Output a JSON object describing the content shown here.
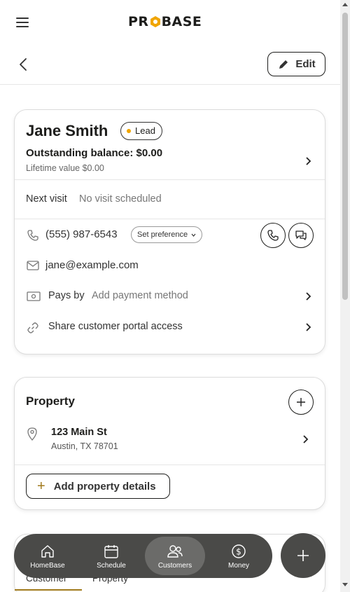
{
  "header": {
    "logo_left": "PR",
    "logo_right": "BASE",
    "edit_label": "Edit"
  },
  "customer": {
    "name": "Jane Smith",
    "status_badge": "Lead",
    "outstanding_balance": "Outstanding balance: $0.00",
    "lifetime_value": "Lifetime value $0.00",
    "next_visit_label": "Next visit",
    "next_visit_value": "No visit scheduled",
    "phone": "(555) 987-6543",
    "set_preference_label": "Set preference",
    "email": "jane@example.com",
    "pays_by_label": "Pays by",
    "pays_by_value": "Add payment method",
    "portal_label": "Share customer portal access"
  },
  "property": {
    "title": "Property",
    "address_line1": "123 Main St",
    "address_line2": "Austin, TX 78701",
    "add_details_label": "Add property details"
  },
  "tabs": [
    {
      "label": "Customer",
      "active": true
    },
    {
      "label": "Property",
      "active": false
    }
  ],
  "bottom_nav": [
    {
      "label": "HomeBase",
      "icon": "home-icon",
      "active": false
    },
    {
      "label": "Schedule",
      "icon": "calendar-icon",
      "active": false
    },
    {
      "label": "Customers",
      "icon": "users-icon",
      "active": true
    },
    {
      "label": "Money",
      "icon": "dollar-icon",
      "active": false
    }
  ],
  "colors": {
    "accent": "#f0a500",
    "accent_dark": "#a07a1c",
    "nav_bg": "#4a4a48",
    "nav_active": "#6b6b69"
  }
}
